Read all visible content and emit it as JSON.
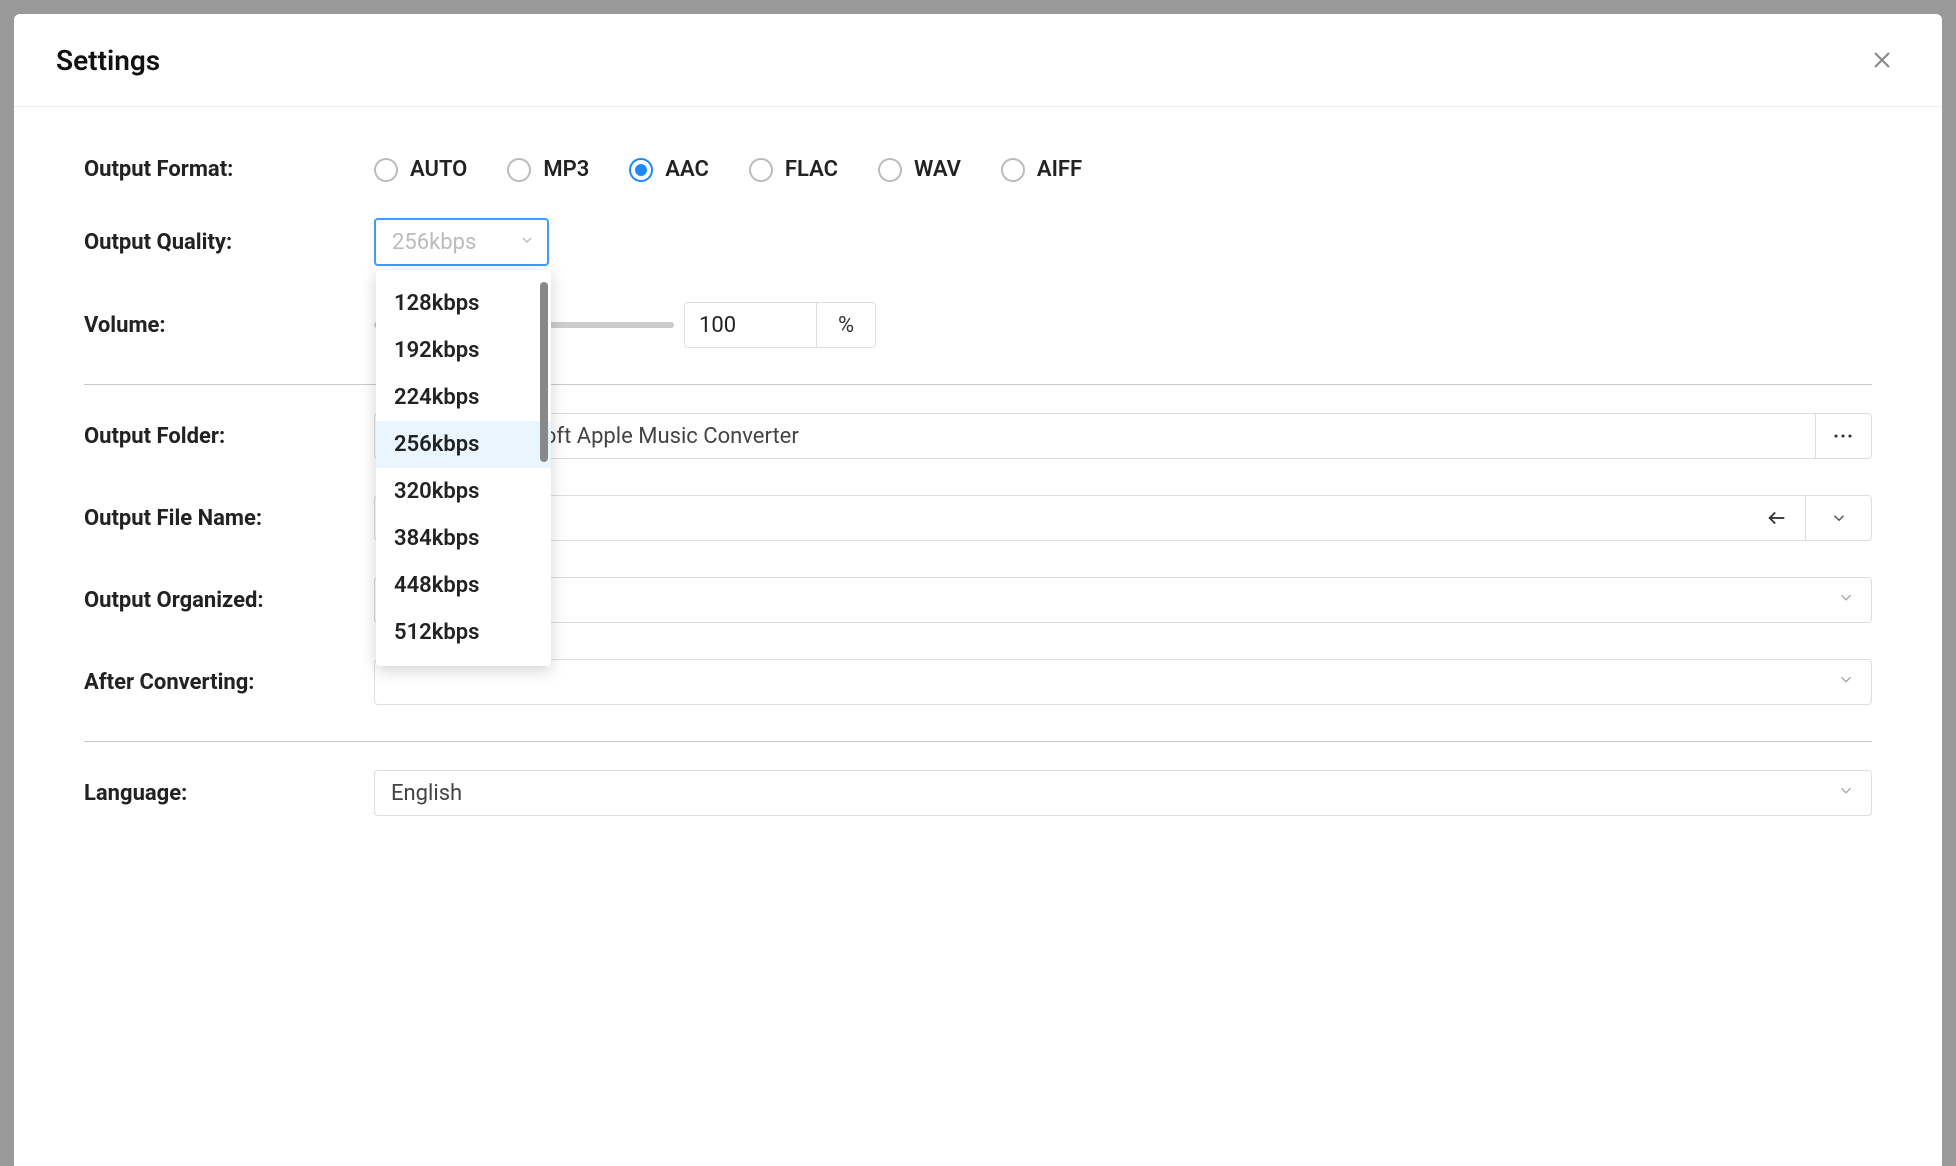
{
  "modal": {
    "title": "Settings"
  },
  "outputFormat": {
    "label": "Output Format:",
    "selected": "AAC",
    "options": [
      "AUTO",
      "MP3",
      "AAC",
      "FLAC",
      "WAV",
      "AIFF"
    ]
  },
  "outputQuality": {
    "label": "Output Quality:",
    "selected": "256kbps",
    "options": [
      "128kbps",
      "192kbps",
      "224kbps",
      "256kbps",
      "320kbps",
      "384kbps",
      "448kbps",
      "512kbps"
    ]
  },
  "volume": {
    "label": "Volume:",
    "value": "100",
    "unit": "%"
  },
  "outputFolder": {
    "label": "Output Folder:",
    "path_visible": "cuments/Ukeysoft Apple Music Converter",
    "browse": "···"
  },
  "outputFileName": {
    "label": "Output File Name:",
    "value": ""
  },
  "outputOrganized": {
    "label": "Output Organized:",
    "value": ""
  },
  "afterConverting": {
    "label": "After Converting:"
  },
  "language": {
    "label": "Language:",
    "value": "English"
  }
}
